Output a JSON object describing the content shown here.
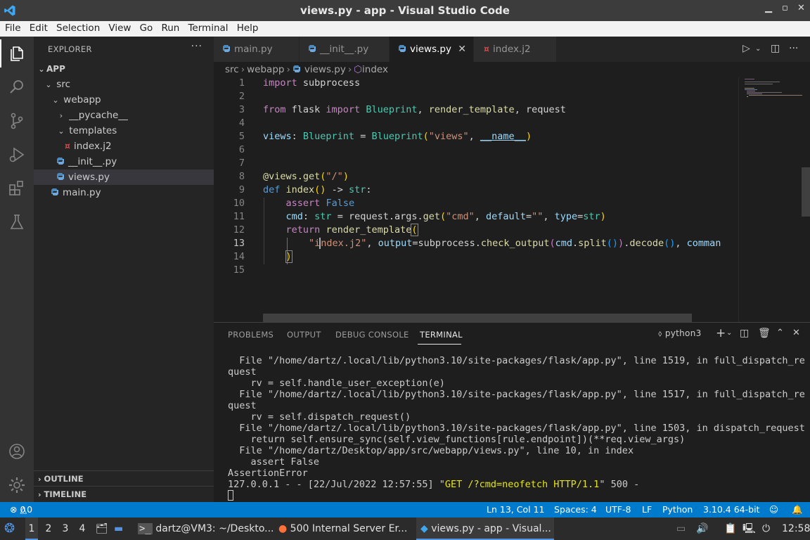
{
  "window": {
    "title": "views.py - app - Visual Studio Code",
    "controls": [
      "minimize",
      "maximize",
      "close"
    ]
  },
  "menu": [
    "File",
    "Edit",
    "Selection",
    "View",
    "Go",
    "Run",
    "Terminal",
    "Help"
  ],
  "activity_bar": [
    "explorer-icon",
    "search-icon",
    "source-control-icon",
    "run-debug-icon",
    "extensions-icon",
    "testing-icon",
    "account-icon",
    "settings-gear-icon"
  ],
  "sidebar": {
    "title": "EXPLORER",
    "more": "···",
    "tree": [
      {
        "label": "APP",
        "kind": "root",
        "chevron": "⌄"
      },
      {
        "label": "src",
        "kind": "folder",
        "chevron": "⌄"
      },
      {
        "label": "webapp",
        "kind": "folder",
        "chevron": "⌄"
      },
      {
        "label": "__pycache__",
        "kind": "folder",
        "chevron": "›"
      },
      {
        "label": "templates",
        "kind": "folder",
        "chevron": "⌄"
      },
      {
        "label": "index.j2",
        "kind": "j2"
      },
      {
        "label": "__init__.py",
        "kind": "py"
      },
      {
        "label": "views.py",
        "kind": "py",
        "selected": true
      },
      {
        "label": "main.py",
        "kind": "py"
      }
    ],
    "outline": "OUTLINE",
    "timeline": "TIMELINE"
  },
  "tabs": [
    {
      "label": "main.py",
      "kind": "py"
    },
    {
      "label": "__init__.py",
      "kind": "py"
    },
    {
      "label": "views.py",
      "kind": "py",
      "active": true,
      "close": "✕"
    },
    {
      "label": "index.j2",
      "kind": "j2"
    }
  ],
  "breadcrumb": [
    "src",
    "webapp",
    "views.py",
    "index"
  ],
  "editor": {
    "line_numbers": [
      "1",
      "2",
      "3",
      "4",
      "5",
      "6",
      "7",
      "8",
      "9",
      "10",
      "11",
      "12",
      "13",
      "14",
      "15"
    ],
    "current_line": "13"
  },
  "panel": {
    "tabs": [
      "PROBLEMS",
      "OUTPUT",
      "DEBUG CONSOLE",
      "TERMINAL"
    ],
    "active_tab": "TERMINAL",
    "shell": "python3",
    "terminal_lines": [
      "  File \"/home/dartz/.local/lib/python3.10/site-packages/flask/app.py\", line 1519, in full_dispatch_re",
      "quest",
      "    rv = self.handle_user_exception(e)",
      "  File \"/home/dartz/.local/lib/python3.10/site-packages/flask/app.py\", line 1517, in full_dispatch_re",
      "quest",
      "    rv = self.dispatch_request()",
      "  File \"/home/dartz/.local/lib/python3.10/site-packages/flask/app.py\", line 1503, in dispatch_request",
      "    return self.ensure_sync(self.view_functions[rule.endpoint])(**req.view_args)",
      "  File \"/home/dartz/Desktop/app/src/webapp/views.py\", line 10, in index",
      "    assert False",
      "AssertionError"
    ],
    "last_line_prefix": "127.0.0.1 - - [22/Jul/2022 12:57:55] \"",
    "last_line_request": "GET /?cmd=neofetch HTTP/1.1",
    "last_line_suffix": "\" 500 -"
  },
  "status": {
    "errors": "0",
    "warnings": "0",
    "position": "Ln 13, Col 11",
    "spaces": "Spaces: 4",
    "encoding": "UTF-8",
    "eol": "LF",
    "language": "Python",
    "interpreter": "3.10.4 64-bit"
  },
  "taskbar": {
    "workspaces": [
      "1",
      "2",
      "3",
      "4"
    ],
    "tasks": [
      {
        "label": "dartz@VM3: ~/Deskto..."
      },
      {
        "label": "500 Internal Server Er..."
      },
      {
        "label": "views.py - app - Visual..."
      }
    ],
    "clock": "12:58"
  },
  "colors": {
    "accent": "#007acc",
    "activity": "#333333",
    "sidebar": "#252526",
    "editor": "#1e1e1e"
  }
}
